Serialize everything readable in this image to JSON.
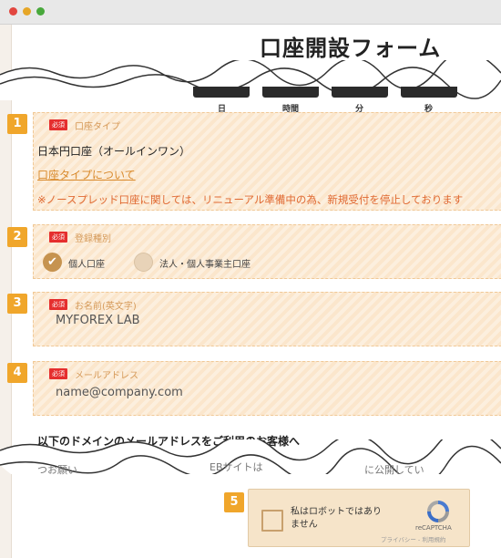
{
  "form_title": "口座開設フォーム",
  "timer_labels": [
    "日",
    "時間",
    "分",
    "秒"
  ],
  "required_tag": "必須",
  "sections": [
    {
      "number": "1",
      "label": "口座タイプ",
      "value": "日本円口座（オールインワン）",
      "link": "口座タイプについて",
      "notice": "※ノースプレッド口座に関しては、リニューアル準備中の為、新規受付を停止しております"
    },
    {
      "number": "2",
      "label": "登録種別",
      "options": [
        {
          "label": "個人口座",
          "selected": true
        },
        {
          "label": "法人・個人事業主口座",
          "selected": false
        }
      ]
    },
    {
      "number": "3",
      "label": "お名前(英文字)",
      "value": "MYFOREX LAB"
    },
    {
      "number": "4",
      "label": "メールアドレス",
      "placeholder": "name@company.com"
    }
  ],
  "domain_heading": "以下のドメインのメールアドレスをご利用のお客様へ",
  "peek_text": {
    "left": "つお願い",
    "mid": "EBサイトは",
    "right": "に公開してい"
  },
  "captcha": {
    "number": "5",
    "text_line1": "私はロボットではあり",
    "text_line2": "ません",
    "brand": "reCAPTCHA",
    "links": "プライバシー - 利用規約"
  },
  "icons": {
    "check": "check-icon",
    "recaptcha": "recaptcha-logo-icon"
  },
  "colors": {
    "badge": "#f0a62b",
    "required": "#e52e2e",
    "notice": "#e06a33",
    "link": "#d98a2c"
  }
}
